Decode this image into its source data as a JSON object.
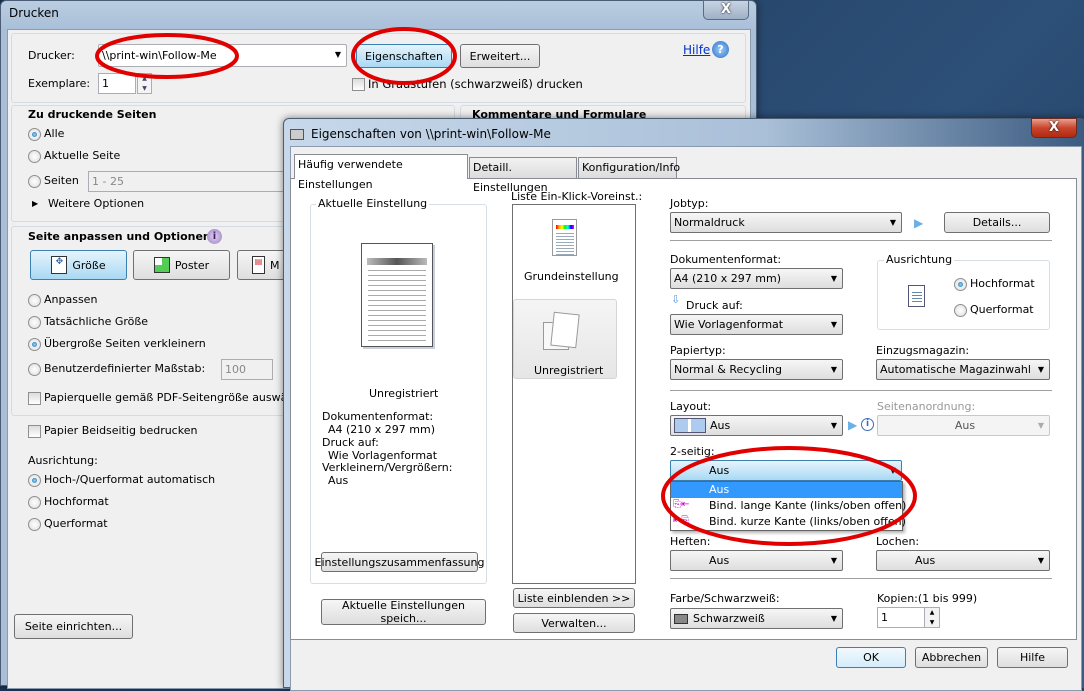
{
  "print_dialog": {
    "title": "Drucken",
    "close": "X",
    "printer_label": "Drucker:",
    "printer_value": "\\\\print-win\\Follow-Me",
    "properties_button": "Eigenschaften",
    "advanced_button": "Erweitert...",
    "help_link": "Hilfe",
    "copies_label": "Exemplare:",
    "copies_value": "1",
    "grayscale_label": "In Graustufen (schwarzweiß) drucken",
    "pages_section": {
      "title": "Zu druckende Seiten",
      "all": "Alle",
      "current": "Aktuelle Seite",
      "pages": "Seiten",
      "pages_value": "1 - 25",
      "more": "Weitere Optionen",
      "selected": "Alle"
    },
    "comments_section": {
      "title": "Kommentare und Formulare"
    },
    "fit_section": {
      "title": "Seite anpassen und Optionen",
      "size_button": "Größe",
      "poster_button": "Poster",
      "third_button": "M",
      "fit": "Anpassen",
      "actual": "Tatsächliche Größe",
      "shrink": "Übergroße Seiten verkleinern",
      "custom": "Benutzerdefinierter Maßstab:",
      "custom_value": "100",
      "paper_source": "Papierquelle gemäß PDF-Seitengröße auswäh",
      "selected": "Übergroße Seiten verkleinern"
    },
    "duplex_label": "Papier Beidseitig bedrucken",
    "orientation": {
      "label": "Ausrichtung:",
      "auto": "Hoch-/Querformat automatisch",
      "portrait": "Hochformat",
      "landscape": "Querformat",
      "selected": "Hoch-/Querformat automatisch"
    },
    "page_setup_button": "Seite einrichten..."
  },
  "properties_dialog": {
    "title": "Eigenschaften von \\\\print-win\\Follow-Me",
    "close": "X",
    "tabs": [
      {
        "label": "Häufig verwendete Einstellungen",
        "active": true
      },
      {
        "label": "Detaill. Einstellungen"
      },
      {
        "label": "Konfiguration/Info"
      }
    ],
    "current": {
      "group": "Aktuelle Einstellung",
      "name": "Unregistriert",
      "lines": [
        "Dokumentenformat:",
        "A4 (210 x 297 mm)",
        "Druck auf:",
        "Wie Vorlagenformat",
        "Verkleinern/Vergrößern:",
        "Aus"
      ],
      "summary_button": "Einstellungszusammenfassung",
      "save_button": "Aktuelle Einstellungen speich..."
    },
    "presets": {
      "label": "Liste Ein-Klick-Voreinst.:",
      "items": [
        "Grundeinstellung",
        "Unregistriert"
      ],
      "selected": "Unregistriert",
      "show_button": "Liste einblenden >>",
      "manage_button": "Verwalten..."
    },
    "jobtype": {
      "label": "Jobtyp:",
      "value": "Normaldruck",
      "details_button": "Details..."
    },
    "docformat": {
      "label": "Dokumentenformat:",
      "value": "A4 (210 x 297 mm)"
    },
    "printon": {
      "label": "Druck auf:",
      "value": "Wie Vorlagenformat"
    },
    "orientation": {
      "label": "Ausrichtung",
      "portrait": "Hochformat",
      "landscape": "Querformat",
      "selected": "Hochformat"
    },
    "papertype": {
      "label": "Papiertyp:",
      "value": "Normal & Recycling"
    },
    "tray": {
      "label": "Einzugsmagazin:",
      "value": "Automatische Magazinwahl"
    },
    "layout": {
      "label": "Layout:",
      "value": "Aus"
    },
    "pageorder": {
      "label": "Seitenanordnung:",
      "value": "Aus"
    },
    "duplex": {
      "label": "2-seitig:",
      "value": "Aus",
      "options": [
        "Aus",
        "Bind. lange Kante (links/oben offen)",
        "Bind. kurze Kante (links/oben offen)"
      ],
      "highlighted": "Aus"
    },
    "staple": {
      "label": "Heften:",
      "value": "Aus"
    },
    "punch": {
      "label": "Lochen:",
      "value": "Aus"
    },
    "color": {
      "label": "Farbe/Schwarzweiß:",
      "value": "Schwarzweiß"
    },
    "copies": {
      "label": "Kopien:(1 bis 999)",
      "value": "1"
    },
    "ok_button": "OK",
    "cancel_button": "Abbrechen",
    "help_button": "Hilfe"
  },
  "colors": {
    "annotation": "#e00000",
    "selection": "#3399ff",
    "link": "#0033cc"
  }
}
